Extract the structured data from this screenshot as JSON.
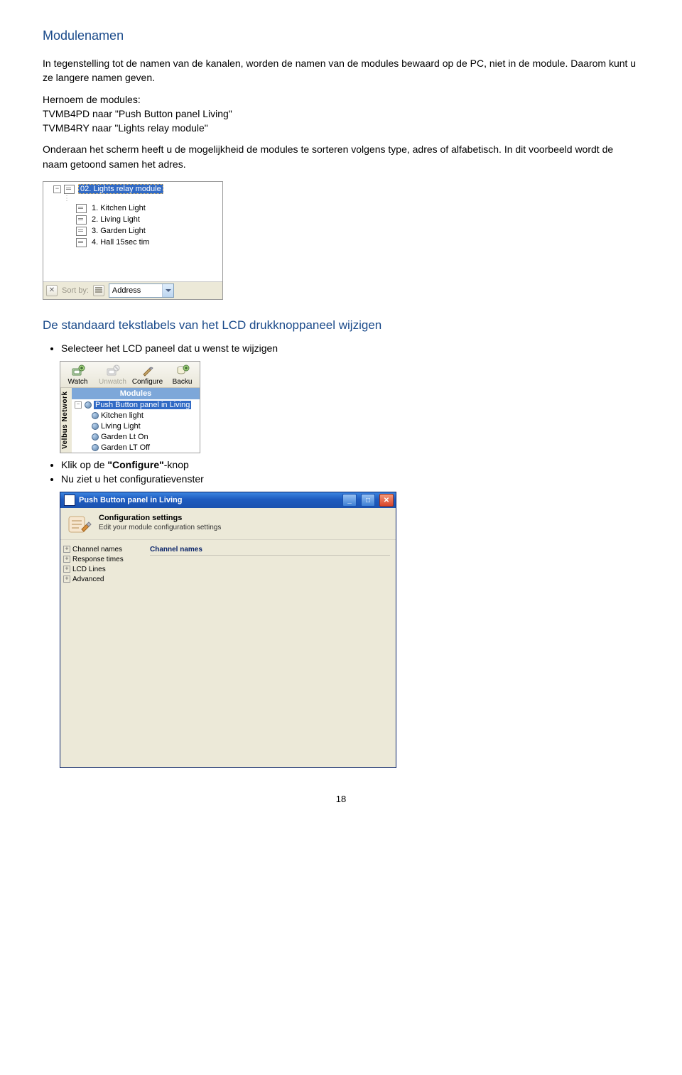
{
  "section1": {
    "title": "Modulenamen",
    "p1": "In tegenstelling tot de namen van de kanalen, worden de namen van de modules bewaard op de PC, niet in de module. Daarom kunt u ze langere namen geven.",
    "p2a": "Hernoem de modules:",
    "p2b": "TVMB4PD naar \"Push Button panel Living\"",
    "p2c": "TVMB4RY naar \"Lights relay module\"",
    "p3": "Onderaan het scherm heeft u de mogelijkheid de modules te sorteren volgens type, adres of alfabetisch. In dit voorbeeld wordt de naam getoond samen het adres."
  },
  "shot1": {
    "root": "02. Lights relay module",
    "children": [
      "1. Kitchen Light",
      "2. Living Light",
      "3. Garden Light",
      "4. Hall  15sec  tim"
    ],
    "sort_label": "Sort by:",
    "combo_value": "Address"
  },
  "section2": {
    "title": "De standaard tekstlabels van het LCD drukknoppaneel wijzigen",
    "b1": "Selecteer het LCD paneel dat u wenst te wijzigen",
    "b2": "Klik op de \"Configure\"-knop",
    "b3": "Nu ziet u het configuratievenster"
  },
  "shot2": {
    "toolbar": [
      {
        "label": "Watch",
        "kind": "watch",
        "disabled": false
      },
      {
        "label": "Unwatch",
        "kind": "unwatch",
        "disabled": true
      },
      {
        "label": "Configure",
        "kind": "configure",
        "disabled": false
      },
      {
        "label": "Backu",
        "kind": "backup",
        "disabled": false
      }
    ],
    "side_tab": "Velbus Network",
    "header": "Modules",
    "root": "Push Button panel in Living",
    "children": [
      "Kitchen light",
      "Living Light",
      "Garden Lt On",
      "Garden LT Off"
    ]
  },
  "shot3": {
    "title": "Push Button panel in Living",
    "heading": "Configuration settings",
    "sub": "Edit your module configuration settings",
    "nav": [
      "Channel names",
      "Response times",
      "LCD Lines",
      "Advanced"
    ],
    "panel_title": "Channel names"
  },
  "page_number": "18",
  "bold1": "\"Configure\""
}
